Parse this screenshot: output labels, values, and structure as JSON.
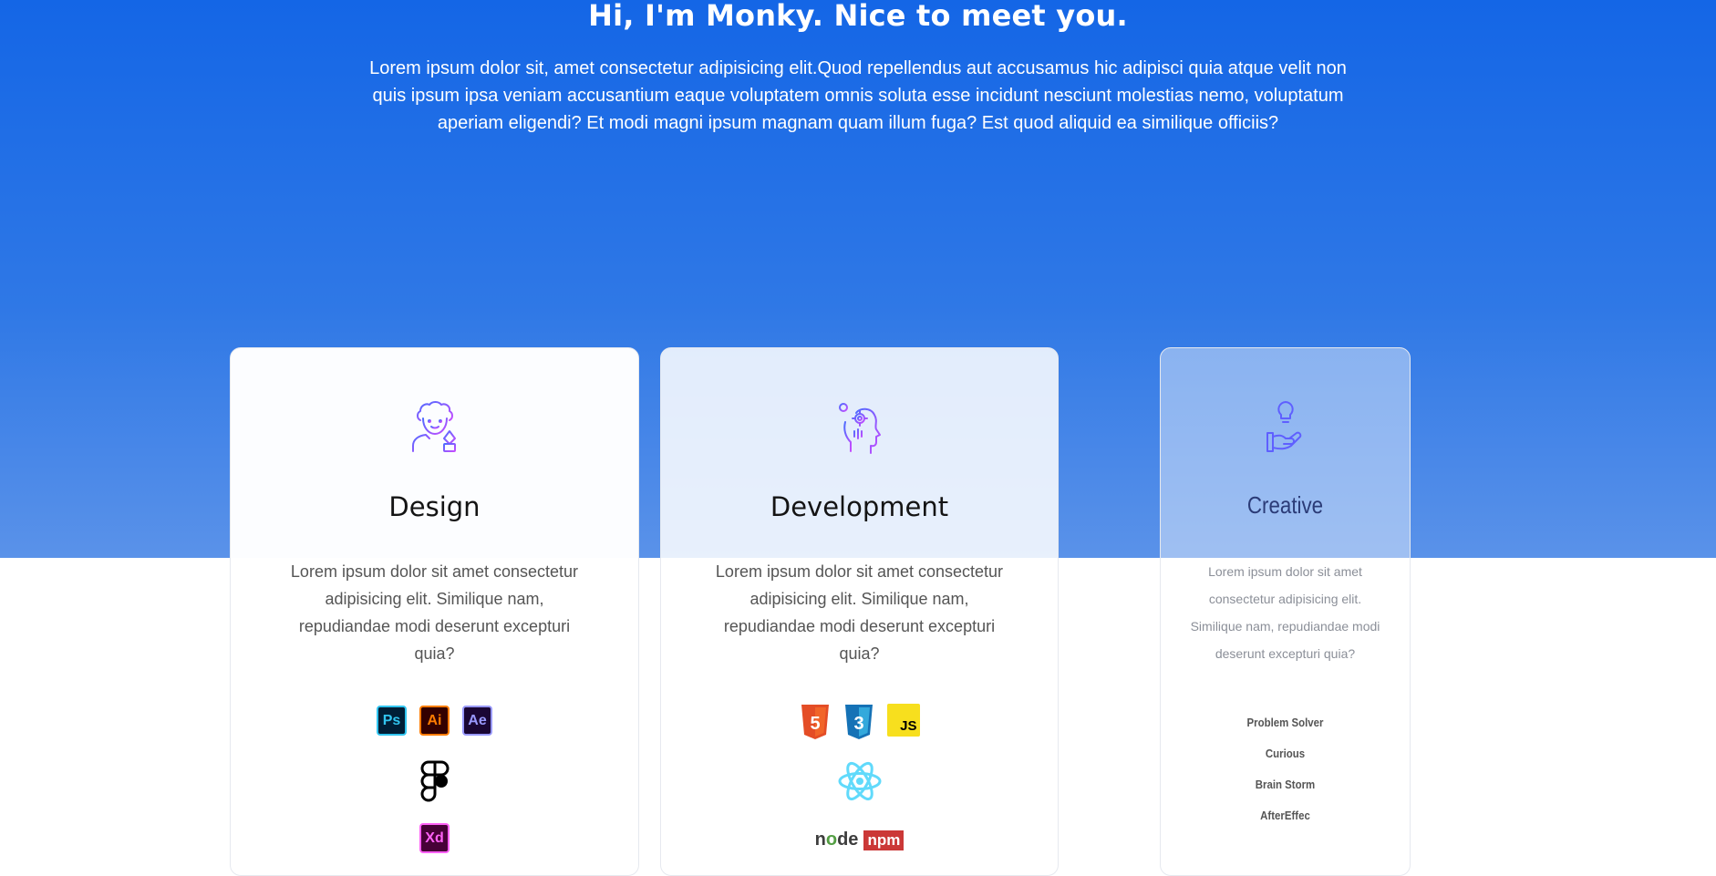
{
  "hero": {
    "title": "Hi, I'm Monky. Nice to meet you.",
    "text": "Lorem ipsum dolor sit, amet consectetur adipisicing elit.Quod repellendus aut accusamus hic adipisci quia atque velit non quis ipsum ipsa veniam accusantium eaque voluptatem omnis soluta esse incidunt nesciunt molestias nemo, voluptatum aperiam eligendi? Et modi magni ipsum magnam quam illum fuga? Est quod aliquid ea similique officiis?"
  },
  "cards": {
    "design": {
      "icon": "designer-avatar-pen-icon",
      "title": "Design",
      "description": "Lorem ipsum dolor sit amet consectetur adipisicing elit. Similique nam, repudiandae modi deserunt excepturi quia?",
      "tools": [
        {
          "name": "photoshop-icon",
          "label": "Ps"
        },
        {
          "name": "illustrator-icon",
          "label": "Ai"
        },
        {
          "name": "after-effects-icon",
          "label": "Ae"
        },
        {
          "name": "figma-icon",
          "label": ""
        },
        {
          "name": "xd-icon",
          "label": "Xd"
        }
      ]
    },
    "development": {
      "icon": "developer-head-gear-icon",
      "title": "Development",
      "description": "Lorem ipsum dolor sit amet consectetur adipisicing elit. Similique nam, repudiandae modi deserunt excepturi quia?",
      "tools": [
        {
          "name": "html5-icon",
          "label": "5"
        },
        {
          "name": "css3-icon",
          "label": "3"
        },
        {
          "name": "javascript-icon",
          "label": "JS"
        },
        {
          "name": "react-icon",
          "label": ""
        },
        {
          "name": "node-icon",
          "label": "node"
        },
        {
          "name": "npm-icon",
          "label": "npm"
        }
      ]
    },
    "creative": {
      "icon": "lightbulb-hand-icon",
      "title": "Creative",
      "description": "Lorem ipsum dolor sit amet consectetur adipisicing elit. Similique nam, repudiandae modi deserunt excepturi quia?",
      "skills": [
        "Problem Solver",
        "Curious",
        "Brain Storm",
        "AfterEffec"
      ]
    }
  },
  "colors": {
    "hero_top": "#1466e6",
    "hero_bottom": "#5a92e9",
    "icon_gradient_start": "#4e6bff",
    "icon_gradient_end": "#c64cff"
  }
}
